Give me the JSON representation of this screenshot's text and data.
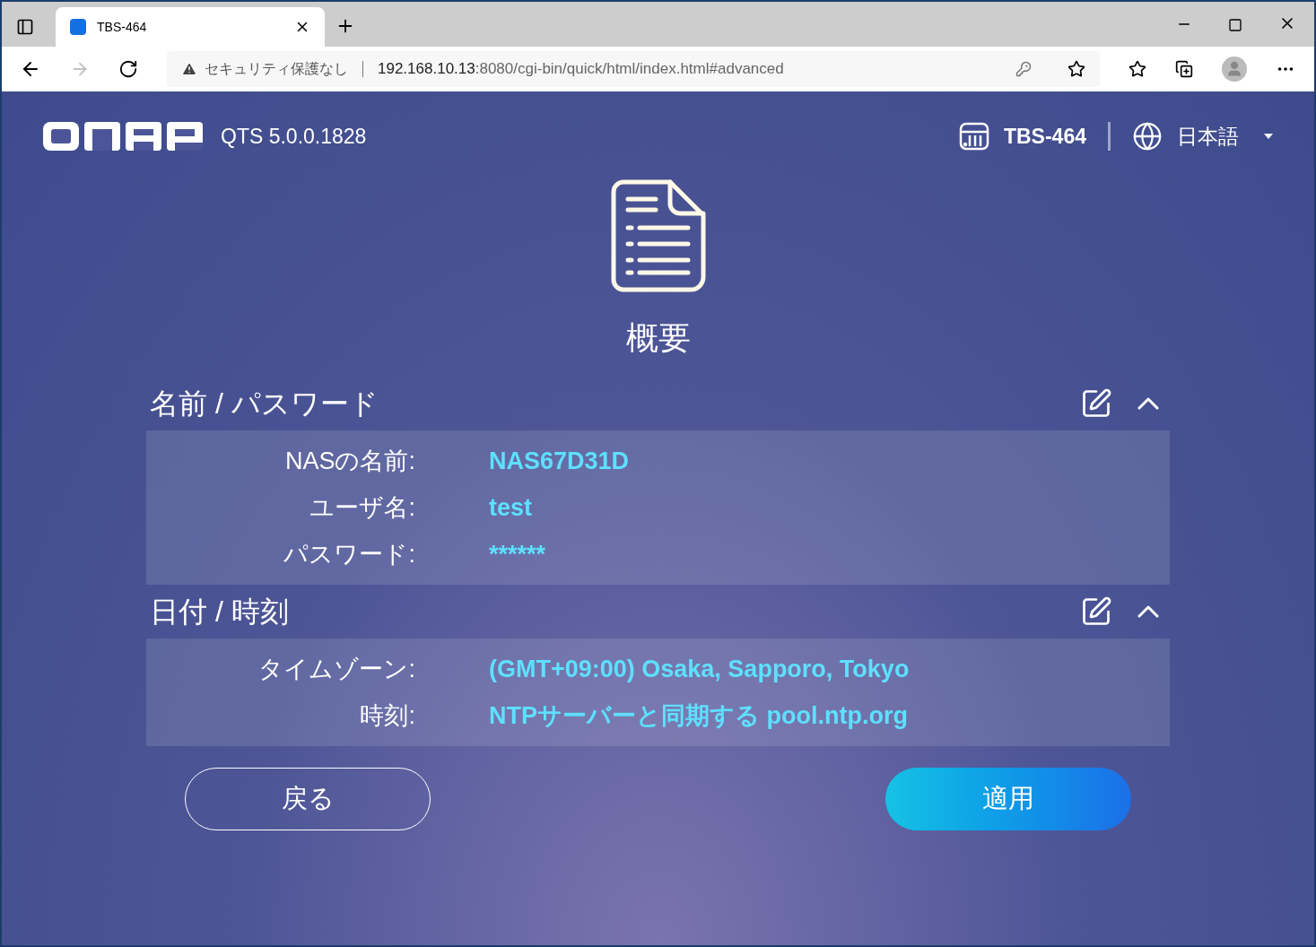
{
  "browser": {
    "tab": {
      "title": "TBS-464",
      "selected": true
    },
    "address": {
      "security": "セキュリティ保護なし",
      "host": "192.168.10.13",
      "rest": ":8080/cgi-bin/quick/html/index.html#advanced"
    }
  },
  "header": {
    "version": "QTS 5.0.0.1828",
    "device": "TBS-464",
    "language": "日本語"
  },
  "page_title": "概要",
  "sections": [
    {
      "title": "名前 / パスワード",
      "expanded": true,
      "rows": [
        {
          "label": "NASの名前:",
          "value": "NAS67D31D"
        },
        {
          "label": "ユーザ名:",
          "value": "test"
        },
        {
          "label": "パスワード:",
          "value": "******"
        }
      ]
    },
    {
      "title": "日付 / 時刻",
      "expanded": true,
      "rows": [
        {
          "label": "タイムゾーン:",
          "value": "(GMT+09:00) Osaka, Sapporo, Tokyo"
        },
        {
          "label": "時刻:",
          "value": "NTPサーバーと同期する pool.ntp.org"
        }
      ]
    }
  ],
  "buttons": [
    {
      "label": "戻る",
      "kind": "outline"
    },
    {
      "label": "適用",
      "kind": "primary"
    }
  ]
}
